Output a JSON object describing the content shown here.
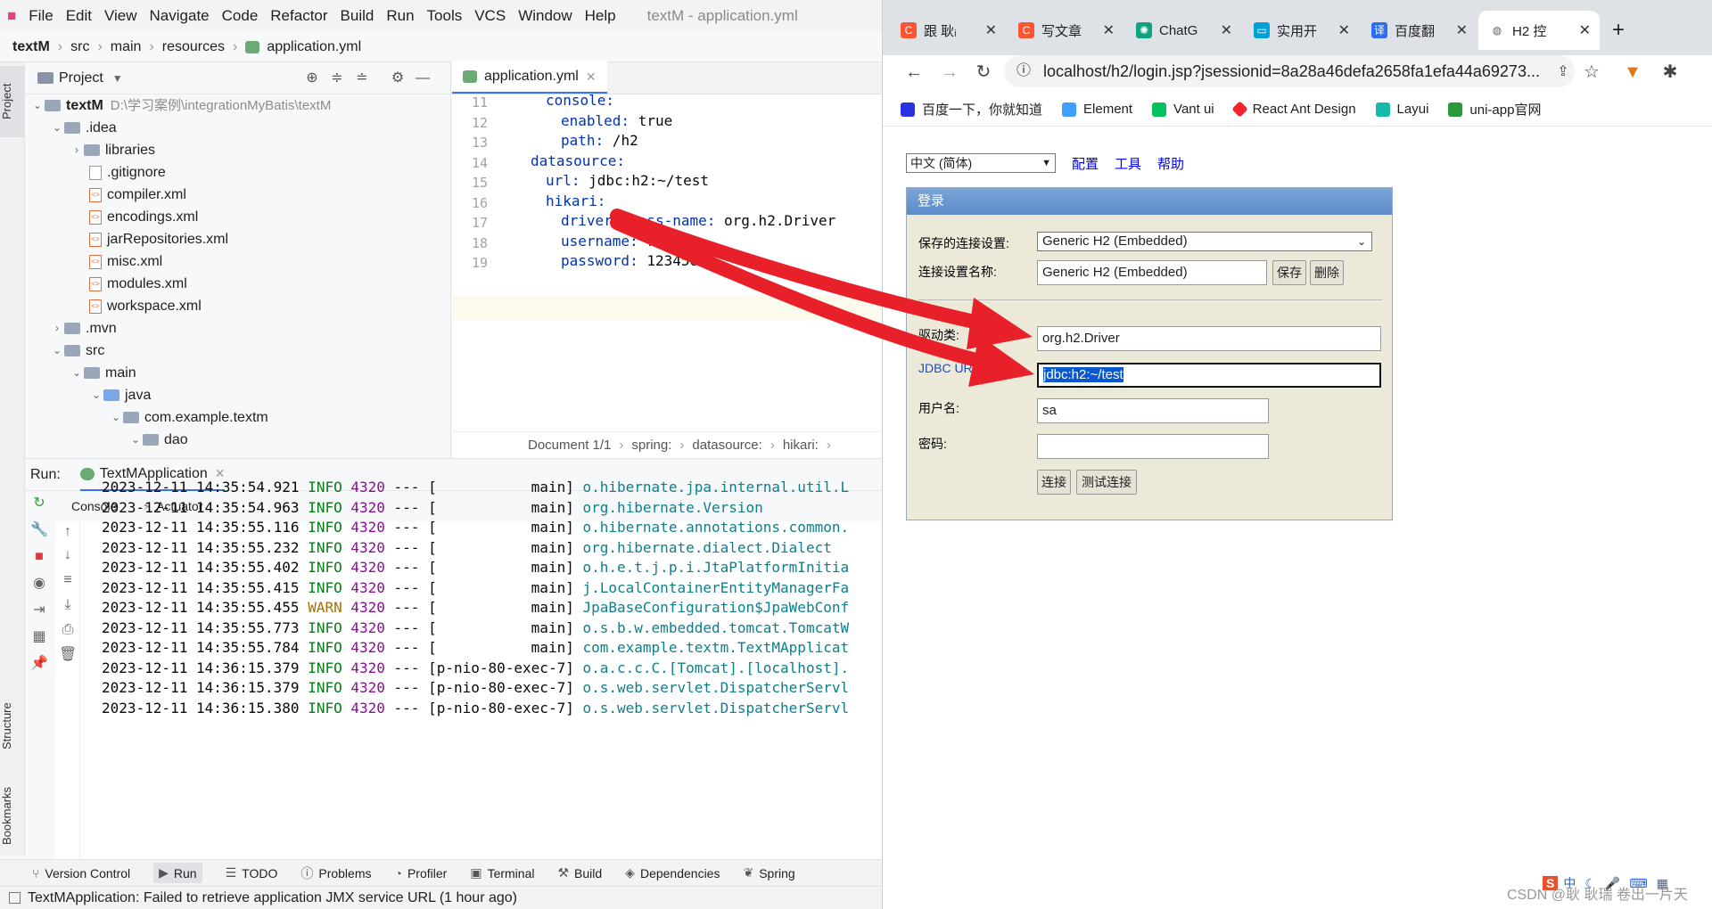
{
  "ide": {
    "window_title": "textM - application.yml",
    "menus": [
      "File",
      "Edit",
      "View",
      "Navigate",
      "Code",
      "Refactor",
      "Build",
      "Run",
      "Tools",
      "VCS",
      "Window",
      "Help"
    ],
    "breadcrumb": [
      "textM",
      "src",
      "main",
      "resources",
      "application.yml"
    ],
    "side_tabs": {
      "project": "Project",
      "structure": "Structure",
      "bookmarks": "Bookmarks"
    },
    "project_panel": {
      "title": "Project",
      "tree": [
        {
          "label": "textM",
          "path": "D:\\学习案例\\integrationMyBatis\\textM",
          "icon": "folder"
        },
        {
          "label": ".idea",
          "icon": "folder"
        },
        {
          "label": "libraries",
          "icon": "folder"
        },
        {
          "label": ".gitignore",
          "icon": "file"
        },
        {
          "label": "compiler.xml",
          "icon": "xml"
        },
        {
          "label": "encodings.xml",
          "icon": "xml"
        },
        {
          "label": "jarRepositories.xml",
          "icon": "xml"
        },
        {
          "label": "misc.xml",
          "icon": "xml"
        },
        {
          "label": "modules.xml",
          "icon": "xml"
        },
        {
          "label": "workspace.xml",
          "icon": "xml"
        },
        {
          "label": ".mvn",
          "icon": "folder"
        },
        {
          "label": "src",
          "icon": "folder"
        },
        {
          "label": "main",
          "icon": "folder"
        },
        {
          "label": "java",
          "icon": "folder"
        },
        {
          "label": "com.example.textm",
          "icon": "package"
        },
        {
          "label": "dao",
          "icon": "package"
        }
      ]
    },
    "editor": {
      "tab": "application.yml",
      "lines": [
        {
          "n": "11",
          "key": "console:",
          "val": ""
        },
        {
          "n": "12",
          "key": "enabled:",
          "val": " true"
        },
        {
          "n": "13",
          "key": "path:",
          "val": " /h2"
        },
        {
          "n": "14",
          "key": "datasource:",
          "val": ""
        },
        {
          "n": "15",
          "key": "url:",
          "val": " jdbc:h2:~/test"
        },
        {
          "n": "16",
          "key": "hikari:",
          "val": ""
        },
        {
          "n": "17",
          "key": "driver-class-name:",
          "val": " org.h2.Driver"
        },
        {
          "n": "18",
          "key": "username:",
          "val": " root"
        },
        {
          "n": "19",
          "key": "password:",
          "val": " 123456"
        }
      ],
      "status": [
        "Document 1/1",
        "spring:",
        "datasource:",
        "hikari:"
      ]
    },
    "run": {
      "label": "Run:",
      "app": "TextMApplication",
      "subtabs": [
        "Console",
        "Actuator"
      ],
      "logs": [
        {
          "ts": "2023-12-11 14:35:54.921",
          "lvl": "INFO",
          "pid": "4320",
          "thread": "[           main]",
          "logger": "o.hibernate.jpa.internal.util.L"
        },
        {
          "ts": "2023-12-11 14:35:54.963",
          "lvl": "INFO",
          "pid": "4320",
          "thread": "[           main]",
          "logger": "org.hibernate.Version"
        },
        {
          "ts": "2023-12-11 14:35:55.116",
          "lvl": "INFO",
          "pid": "4320",
          "thread": "[           main]",
          "logger": "o.hibernate.annotations.common."
        },
        {
          "ts": "2023-12-11 14:35:55.232",
          "lvl": "INFO",
          "pid": "4320",
          "thread": "[           main]",
          "logger": "org.hibernate.dialect.Dialect"
        },
        {
          "ts": "2023-12-11 14:35:55.402",
          "lvl": "INFO",
          "pid": "4320",
          "thread": "[           main]",
          "logger": "o.h.e.t.j.p.i.JtaPlatformInitia"
        },
        {
          "ts": "2023-12-11 14:35:55.415",
          "lvl": "INFO",
          "pid": "4320",
          "thread": "[           main]",
          "logger": "j.LocalContainerEntityManagerFa"
        },
        {
          "ts": "2023-12-11 14:35:55.455",
          "lvl": "WARN",
          "pid": "4320",
          "thread": "[           main]",
          "logger": "JpaBaseConfiguration$JpaWebConf"
        },
        {
          "ts": "2023-12-11 14:35:55.773",
          "lvl": "INFO",
          "pid": "4320",
          "thread": "[           main]",
          "logger": "o.s.b.w.embedded.tomcat.TomcatW"
        },
        {
          "ts": "2023-12-11 14:35:55.784",
          "lvl": "INFO",
          "pid": "4320",
          "thread": "[           main]",
          "logger": "com.example.textm.TextMApplicat"
        },
        {
          "ts": "2023-12-11 14:36:15.379",
          "lvl": "INFO",
          "pid": "4320",
          "thread": "[p-nio-80-exec-7]",
          "logger": "o.a.c.c.C.[Tomcat].[localhost]."
        },
        {
          "ts": "2023-12-11 14:36:15.379",
          "lvl": "INFO",
          "pid": "4320",
          "thread": "[p-nio-80-exec-7]",
          "logger": "o.s.web.servlet.DispatcherServl"
        },
        {
          "ts": "2023-12-11 14:36:15.380",
          "lvl": "INFO",
          "pid": "4320",
          "thread": "[p-nio-80-exec-7]",
          "logger": "o.s.web.servlet.DispatcherServl"
        }
      ]
    },
    "bottom_tabs": [
      "Version Control",
      "Run",
      "TODO",
      "Problems",
      "Profiler",
      "Terminal",
      "Build",
      "Dependencies",
      "Spring"
    ],
    "status_message": "TextMApplication: Failed to retrieve application JMX service URL (1 hour ago)"
  },
  "browser": {
    "tabs": [
      {
        "label": "跟 耿ᵢ",
        "color": "#fc5531"
      },
      {
        "label": "写文章",
        "color": "#fc5531"
      },
      {
        "label": "ChatG",
        "color": "#10a37f"
      },
      {
        "label": "实用开",
        "color": "#00a1d6"
      },
      {
        "label": "百度翻",
        "color": "#2d6ef0"
      },
      {
        "label": "H2 控",
        "color": "#5f6368"
      }
    ],
    "new_tab": "+",
    "url": "localhost/h2/login.jsp?jsessionid=8a28a46defa2658fa1efa44a69273...",
    "bookmarks": [
      {
        "label": "百度一下，你就知道",
        "color": "#2932e1"
      },
      {
        "label": "Element",
        "color": "#409eff"
      },
      {
        "label": "Vant ui",
        "color": "#07c160"
      },
      {
        "label": "React Ant Design",
        "color": "#f5222d"
      },
      {
        "label": "Layui",
        "color": "#16baaa"
      },
      {
        "label": "uni-app官网",
        "color": "#2b9939"
      }
    ],
    "h2": {
      "language": "中文 (简体)",
      "links": [
        "配置",
        "工具",
        "帮助"
      ],
      "box_title": "登录",
      "saved_settings_label": "保存的连接设置:",
      "saved_settings_value": "Generic H2 (Embedded)",
      "settings_name_label": "连接设置名称:",
      "settings_name_value": "Generic H2 (Embedded)",
      "save_btn": "保存",
      "delete_btn": "删除",
      "driver_label": "驱动类:",
      "driver_value": "org.h2.Driver",
      "jdbc_label": "JDBC URL:",
      "jdbc_value": "jdbc:h2:~/test",
      "user_label": "用户名:",
      "user_value": "sa",
      "password_label": "密码:",
      "password_value": "",
      "connect_btn": "连接",
      "test_btn": "测试连接"
    }
  },
  "watermark": "CSDN @耿 耿瑞 卷出一片天",
  "colors": {
    "arrow": "#e8202a",
    "accent": "#3574f0"
  }
}
